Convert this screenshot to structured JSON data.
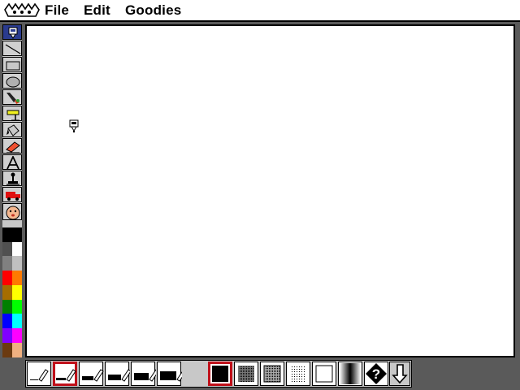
{
  "menu": {
    "items": [
      "File",
      "Edit",
      "Goodies"
    ]
  },
  "toolbox": {
    "tools": [
      {
        "name": "brush-icon",
        "active": true
      },
      {
        "name": "line-icon"
      },
      {
        "name": "rectangle-icon"
      },
      {
        "name": "oval-icon"
      },
      {
        "name": "paintbrush-icon"
      },
      {
        "name": "spray-paint-icon"
      },
      {
        "name": "paint-bucket-icon"
      },
      {
        "name": "eraser-icon"
      },
      {
        "name": "text-tool-icon"
      },
      {
        "name": "rubber-stamp-icon"
      },
      {
        "name": "truck-icon"
      },
      {
        "name": "face-stamp-icon"
      }
    ],
    "palette": [
      [
        "#000000",
        "#000000"
      ],
      [
        "#505050",
        "#ffffff"
      ],
      [
        "#808080",
        "#c0c0c0"
      ],
      [
        "#ff0000",
        "#ff7a00"
      ],
      [
        "#a56d00",
        "#ffff00"
      ],
      [
        "#008000",
        "#00ff00"
      ],
      [
        "#0000ff",
        "#00ffff"
      ],
      [
        "#8000ff",
        "#ff00ff"
      ],
      [
        "#6b3a10",
        "#f0b080"
      ]
    ]
  },
  "bottombar": {
    "brush_sizes": [
      1,
      2,
      3,
      4,
      5,
      6
    ],
    "selected_brush_size": 2,
    "patterns": [
      "solid-black",
      "dense-dots",
      "medium-dots",
      "light-dots",
      "white",
      "gradient-dither"
    ],
    "selected_pattern": "solid-black",
    "help_icon": "question-diamond-icon",
    "undo_icon": "undo-arrow-icon"
  }
}
